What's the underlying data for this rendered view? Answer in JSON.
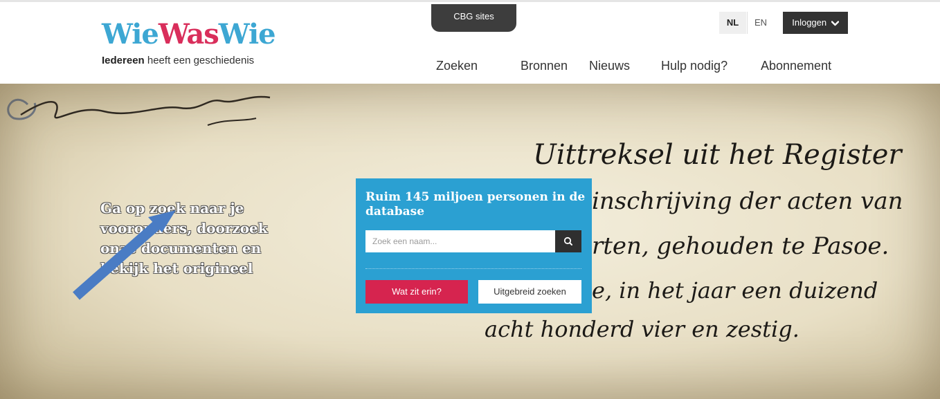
{
  "header": {
    "logo": {
      "part1": "Wie",
      "part2": "Was",
      "part3": "Wie"
    },
    "tagline_bold": "Iedereen",
    "tagline_rest": " heeft een geschiedenis",
    "cbg_sites": "CBG sites",
    "lang_nl": "NL",
    "lang_en": "EN",
    "login": "Inloggen"
  },
  "nav": {
    "items": [
      "Zoeken",
      "Bronnen",
      "Nieuws",
      "Hulp nodig?",
      "Abonnement"
    ]
  },
  "hero": {
    "intro_text": "Ga op zoek naar je voorouders, doorzoek onze documenten en bekijk het origineel",
    "handwriting": [
      "Uittreksel uit het Register",
      "inschrijving der acten van",
      "rten, gehouden te Pasoe.",
      "e, in het jaar een duizend",
      "acht honderd vier en zestig."
    ]
  },
  "search": {
    "title": "Ruim 145 miljoen personen in de database",
    "placeholder": "Zoek een naam...",
    "what_button": "Wat zit erin?",
    "advanced_button": "Uitgebreid zoeken"
  },
  "icons": {
    "search": "search-icon",
    "login_chevron": "chevron-down-icon",
    "annotation": "arrow-annotation"
  },
  "colors": {
    "brand_blue": "#2ba0d2",
    "brand_red": "#d6244f",
    "dark": "#333333",
    "annotation_arrow": "#4a7cc4"
  }
}
